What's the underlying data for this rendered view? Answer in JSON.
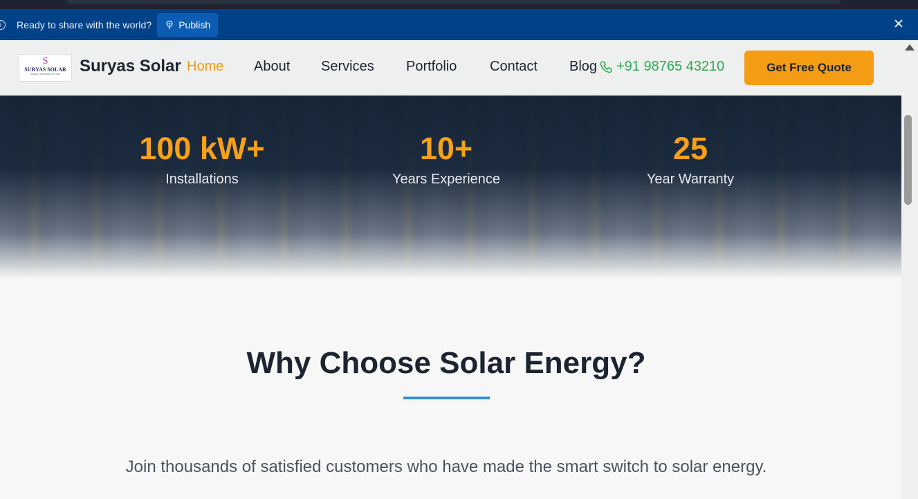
{
  "publish_bar": {
    "message": "Ready to share with the world?",
    "publish_label": "Publish"
  },
  "nav": {
    "logo_text": "SURYAS SOLAR",
    "logo_sub": "ENERGY POWERED SYSTEM",
    "brand": "Suryas Solar",
    "links": [
      "Home",
      "About",
      "Services",
      "Portfolio",
      "Contact",
      "Blog"
    ],
    "active_link": "Home",
    "phone": "+91 98765 43210",
    "cta_label": "Get Free Quote"
  },
  "stats": [
    {
      "value": "100 kW+",
      "label": "Installations"
    },
    {
      "value": "10+",
      "label": "Years Experience"
    },
    {
      "value": "25",
      "label": "Year Warranty"
    }
  ],
  "section": {
    "heading": "Why Choose Solar Energy?",
    "subtext": "Join thousands of satisfied customers who have made the smart switch to solar energy."
  },
  "colors": {
    "accent": "#f49d14",
    "publish_bar": "#004288",
    "phone": "#2ea94e",
    "underline": "#2f8fd6"
  }
}
